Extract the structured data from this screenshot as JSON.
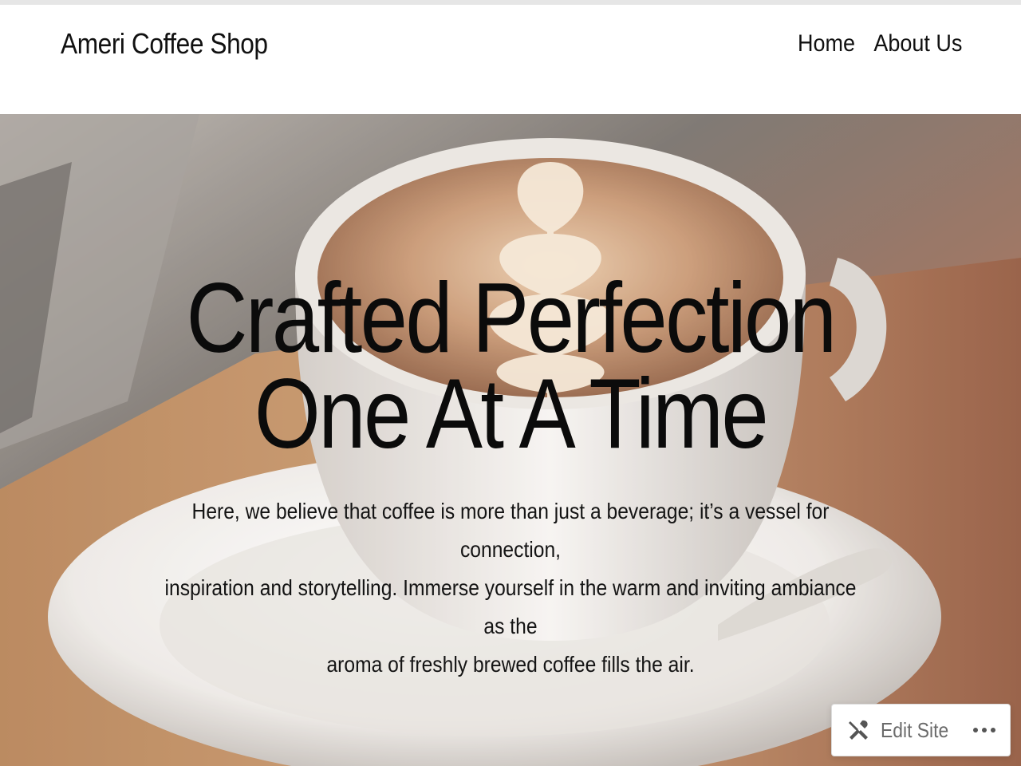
{
  "header": {
    "site_title": "Ameri Coffee Shop",
    "nav": [
      {
        "label": "Home"
      },
      {
        "label": "About Us"
      }
    ]
  },
  "hero": {
    "heading_line1": "Crafted Perfection",
    "heading_line2": "One At A Time",
    "text_line1": "Here, we believe that coffee is more than just a beverage; it’s a vessel for connection,",
    "text_line2": "inspiration and storytelling. Immerse yourself in the warm and inviting ambiance as the",
    "text_line3": "aroma of freshly brewed coffee fills the air.",
    "image": "latte-art-cup"
  },
  "admin_bar": {
    "edit_label": "Edit Site",
    "edit_icon": "tools-icon",
    "more_icon": "more-horizontal-icon"
  },
  "colors": {
    "text": "#111111",
    "muted": "#6b6b6b",
    "hero_brown": "#8a5a3c"
  }
}
